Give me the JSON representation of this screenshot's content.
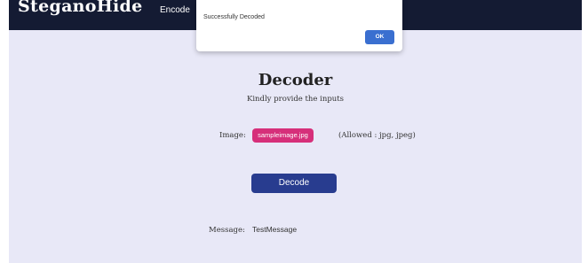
{
  "navbar": {
    "brand": "SteganoHide",
    "links": [
      "Encode"
    ]
  },
  "dialog": {
    "message": "Successfully Decoded",
    "ok_label": "OK"
  },
  "main": {
    "title": "Decoder",
    "subtitle": "Kindly provide the inputs",
    "image_label": "Image:",
    "selected_file": "sampleimage.jpg",
    "allowed_text": "(Allowed : jpg, jpeg)",
    "decode_label": "Decode",
    "message_label": "Message:",
    "message_value": "TestMessage"
  },
  "colors": {
    "navbar_bg": "#141b33",
    "page_bg": "#e8e8f7",
    "file_chip": "#d62f7a",
    "decode_button": "#283c8f",
    "dialog_ok": "#3a6fd0"
  }
}
